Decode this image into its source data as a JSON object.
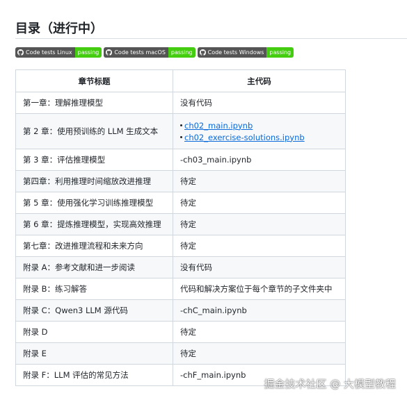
{
  "section": {
    "title": "目录（进行中）"
  },
  "badges": [
    {
      "label": "Code tests Linux",
      "status": "passing"
    },
    {
      "label": "Code tests macOS",
      "status": "passing"
    },
    {
      "label": "Code tests Windows",
      "status": "passing"
    }
  ],
  "table": {
    "headers": [
      "章节标题",
      "主代码"
    ],
    "rows": [
      {
        "title": "第一章：理解推理模型",
        "code": "没有代码"
      },
      {
        "title": "第 2 章：使用预训练的 LLM 生成文本",
        "links": [
          "ch02_main.ipynb",
          "ch02_exercise-solutions.ipynb"
        ]
      },
      {
        "title": "第 3 章：评估推理模型",
        "code": "-ch03_main.ipynb"
      },
      {
        "title": "第四章：利用推理时间缩放改进推理",
        "code": "待定"
      },
      {
        "title": "第 5 章：使用强化学习训练推理模型",
        "code": "待定"
      },
      {
        "title": "第 6 章：提炼推理模型，实现高效推理",
        "code": "待定"
      },
      {
        "title": "第七章：改进推理流程和未来方向",
        "code": "待定"
      },
      {
        "title": "附录 A：参考文献和进一步阅读",
        "code": "没有代码"
      },
      {
        "title": "附录 B：练习解答",
        "code": "代码和解决方案位于每个章节的子文件夹中"
      },
      {
        "title": "附录 C：Qwen3 LLM 源代码",
        "code": "-chC_main.ipynb"
      },
      {
        "title": "附录 D",
        "code": "待定"
      },
      {
        "title": "附录 E",
        "code": "待定"
      },
      {
        "title": "附录 F：LLM 评估的常见方法",
        "code": "-chF_main.ipynb"
      }
    ]
  },
  "watermark": "掘金技术社区 @ 大模型教程"
}
